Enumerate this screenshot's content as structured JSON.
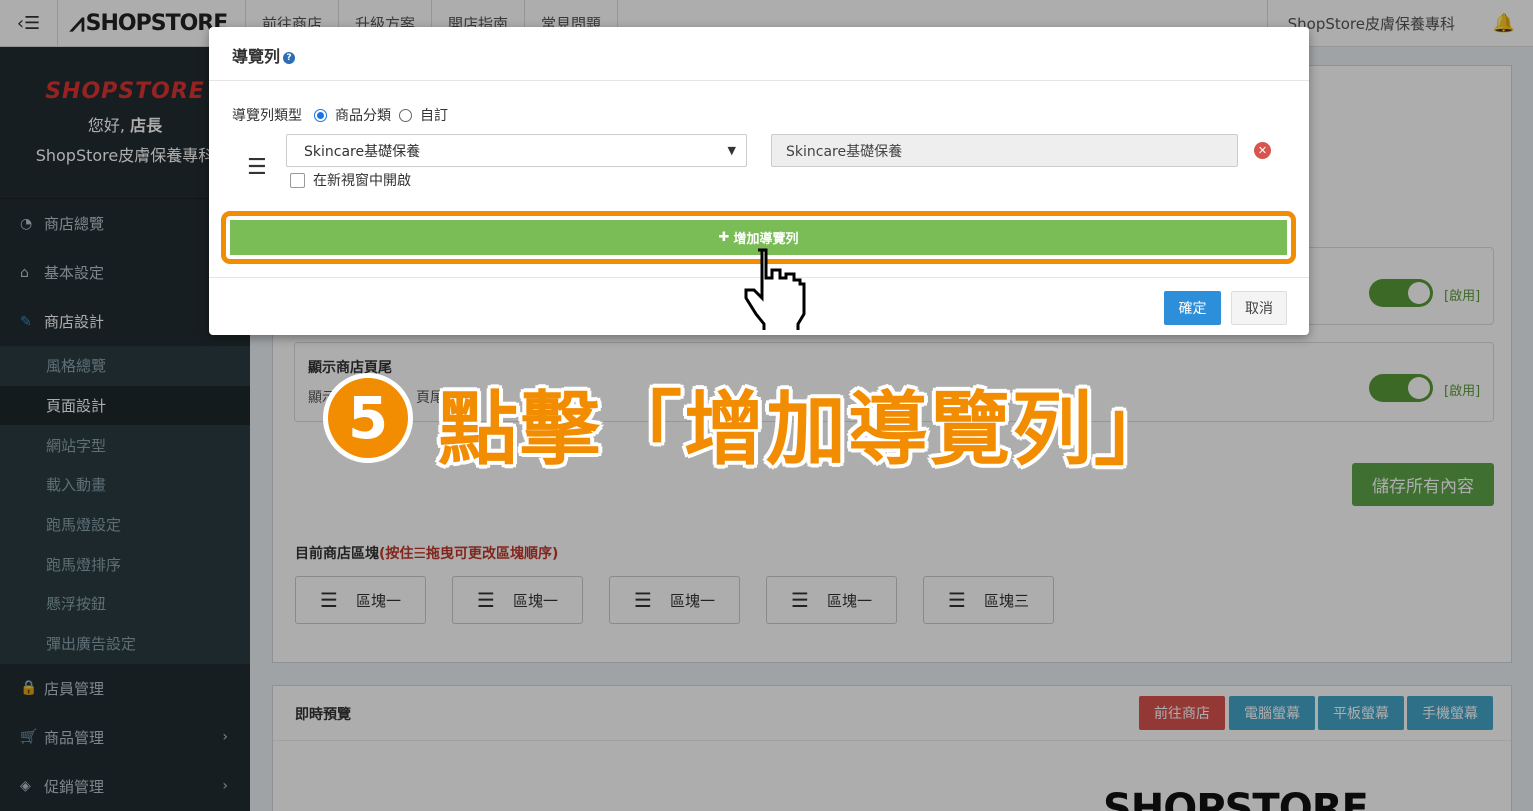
{
  "topbar": {
    "brand": "SHOPSTORE",
    "nav": [
      "前往商店",
      "升級方案",
      "開店指南",
      "常見問題"
    ],
    "store_name": "ShopStore皮膚保養專科"
  },
  "sidebar": {
    "brand": "SHOPSTORE",
    "greeting_prefix": "您好,",
    "greeting_role": "店長",
    "store_name": "ShopStore皮膚保養專科",
    "items": {
      "overview": "商店總覽",
      "basic": "基本設定",
      "design": "商店設計",
      "staff": "店員管理",
      "products": "商品管理",
      "promo": "促銷管理"
    },
    "subitems": [
      "風格總覽",
      "頁面設計",
      "網站字型",
      "載入動畫",
      "跑馬燈設定",
      "跑馬燈排序",
      "懸浮按鈕",
      "彈出廣告設定"
    ],
    "active_subitem": "頁面設計"
  },
  "content": {
    "footer_box_title": "顯示商店頁尾",
    "footer_box_desc_a": "顯示",
    "footer_box_desc_b": "頁尾",
    "enabled_label": "[啟用]",
    "save_all": "儲存所有內容",
    "blocks_title": "目前商店區塊",
    "blocks_hint": "(按住☰拖曳可更改區塊順序)",
    "blocks": [
      "區塊一",
      "區塊一",
      "區塊一",
      "區塊一",
      "區塊三"
    ],
    "preview_title": "即時預覽",
    "preview_buttons": [
      "前往商店",
      "電腦螢幕",
      "平板螢幕",
      "手機螢幕"
    ],
    "preview_logo": "SHOPSTORE"
  },
  "modal": {
    "title": "導覽列",
    "type_label": "導覽列類型",
    "type_options": [
      "商品分類",
      "自訂"
    ],
    "type_selected": "商品分類",
    "category_select": "Skincare基礎保養",
    "name_value": "Skincare基礎保養",
    "new_window_label": "在新視窗中開啟",
    "add_button": "增加導覽列",
    "ok": "確定",
    "cancel": "取消"
  },
  "annotation": {
    "step": "5",
    "text": "點擊「增加導覽列」"
  },
  "colors": {
    "accent_orange": "#f28c00",
    "add_green": "#7abd57",
    "ok_blue": "#2d8fd9",
    "sidebar_bg": "#222d32"
  }
}
